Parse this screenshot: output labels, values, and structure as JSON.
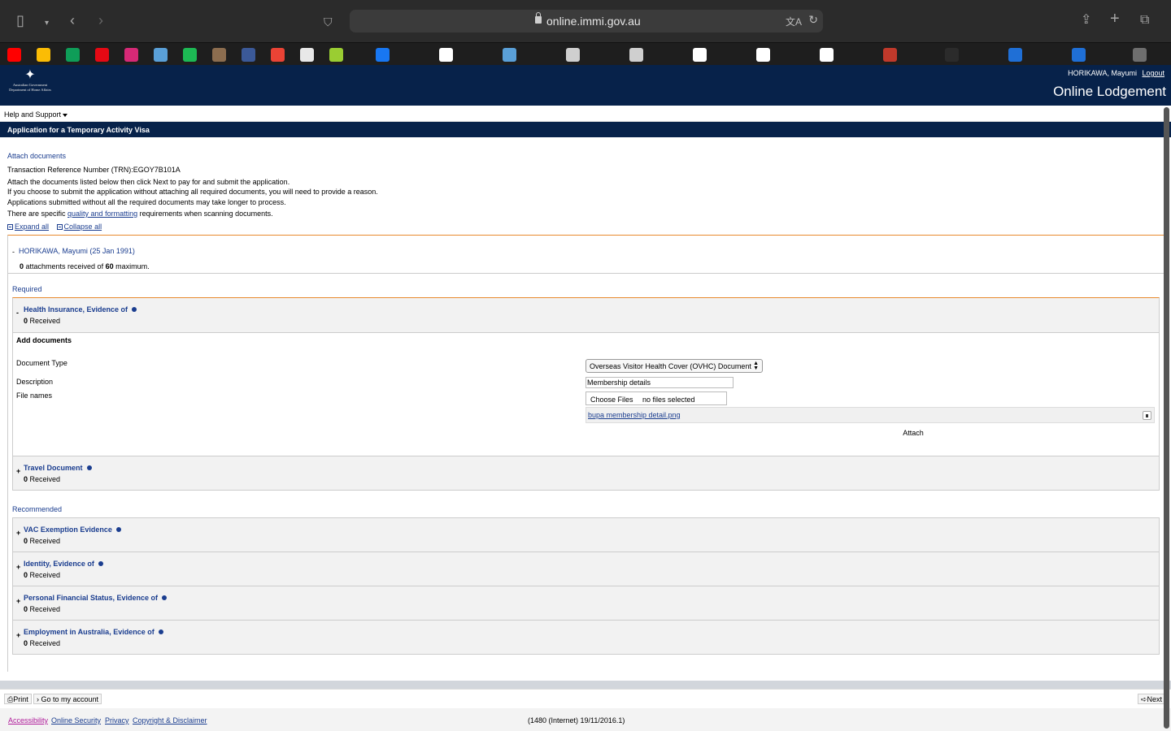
{
  "browser": {
    "url": "online.immi.gov.au",
    "icons": [
      "sidebar-icon",
      "chevron-down-icon",
      "back-icon",
      "forward-icon",
      "shield-icon",
      "lock-icon",
      "translate-icon",
      "reload-icon",
      "share-icon",
      "new-tab-icon",
      "tab-overview-icon"
    ],
    "favorites": [
      {
        "name": "youtube-favicon",
        "color": "#ff0000"
      },
      {
        "name": "photos-favicon",
        "color": "#fbbc05"
      },
      {
        "name": "sheets-favicon",
        "color": "#0f9d58"
      },
      {
        "name": "netflix-favicon",
        "color": "#e50914"
      },
      {
        "name": "instagram-favicon",
        "color": "#d62976"
      },
      {
        "name": "passwords-favicon",
        "color": "#5aa0d8"
      },
      {
        "name": "spotify-favicon",
        "color": "#1db954"
      },
      {
        "name": "game-favicon",
        "color": "#8c6d4f"
      },
      {
        "name": "facebook-square-favicon",
        "color": "#3b5998"
      },
      {
        "name": "gmail-favicon",
        "color": "#ea4335"
      },
      {
        "name": "pwc-favicon",
        "color": "#e8e8e8"
      },
      {
        "name": "docs-favicon",
        "color": "#9acd32"
      },
      {
        "name": "facebook-favicon",
        "color": "#1877f2"
      },
      {
        "name": "immi-favicon",
        "color": "#ffffff"
      },
      {
        "name": "keys-favicon",
        "color": "#5aa0d8"
      },
      {
        "name": "arrow-favicon-1",
        "color": "#cfcfcf"
      },
      {
        "name": "arrow-favicon-2",
        "color": "#cfcfcf"
      },
      {
        "name": "blank-favicon",
        "color": "#ffffff"
      },
      {
        "name": "google-favicon",
        "color": "#ffffff"
      },
      {
        "name": "red-cross-favicon",
        "color": "#ffffff"
      },
      {
        "name": "flower-favicon",
        "color": "#c0392b"
      },
      {
        "name": "star-favicon",
        "color": "#2b2b2b"
      },
      {
        "name": "health-favicon-1",
        "color": "#1f6fd6"
      },
      {
        "name": "health-favicon-2",
        "color": "#1f6fd6"
      },
      {
        "name": "w-favicon",
        "color": "#6e6e6e"
      }
    ]
  },
  "header": {
    "gov_line1": "Australian Government",
    "gov_line2": "Department of Home Affairs",
    "user": "HORIKAWA, Mayumi",
    "logout": "Logout",
    "app_name": "Online Lodgement",
    "help": "Help and Support"
  },
  "page_title": "Application for a Temporary Activity Visa",
  "intro": {
    "step": "Attach documents",
    "trn": "Transaction Reference Number (TRN):EGOY7B101A",
    "line1": "Attach the documents listed below then click Next to pay for and submit the application.",
    "line2": "If you choose to submit the application without attaching all required documents, you will need to provide a reason.",
    "line3": "Applications submitted without all the required documents may take longer to process.",
    "line4_pre": "There are specific ",
    "line4_link": "quality and formatting",
    "line4_post": " requirements when scanning documents."
  },
  "toggles": {
    "expand": "Expand all",
    "collapse": "Collapse all"
  },
  "applicant": {
    "toggle": "-",
    "name": "HORIKAWA, Mayumi (25 Jan 1991)",
    "count": "0",
    "count_mid": " attachments received of ",
    "max": "60",
    "count_end": " maximum."
  },
  "required_label": "Required",
  "recommended_label": "Recommended",
  "received_suffix": " Received",
  "health": {
    "toggle": "-",
    "title": "Health Insurance, Evidence of",
    "received": "0",
    "add_docs": "Add documents",
    "doc_type_label": "Document Type",
    "doc_type_value": "Overseas Visitor Health Cover (OVHC) Document",
    "description_label": "Description",
    "description_value": "Membership details",
    "file_names_label": "File names",
    "choose_files": "Choose Files",
    "no_files": "no files selected",
    "file": "bupa membership detail.png",
    "attach": "Attach"
  },
  "travel": {
    "toggle": "+",
    "title": "Travel Document",
    "received": "0"
  },
  "recommended": [
    {
      "toggle": "+",
      "title": "VAC Exemption Evidence",
      "received": "0"
    },
    {
      "toggle": "+",
      "title": "Identity, Evidence of",
      "received": "0"
    },
    {
      "toggle": "+",
      "title": "Personal Financial Status, Evidence of",
      "received": "0"
    },
    {
      "toggle": "+",
      "title": "Employment in Australia, Evidence of",
      "received": "0"
    }
  ],
  "footer": {
    "print": "Print",
    "account": "Go to my account",
    "next": "Next",
    "accessibility": "Accessibility",
    "security": "Online Security",
    "privacy": "Privacy",
    "copyright": "Copyright & Disclaimer",
    "version": "(1480 (Internet) 19/11/2016.1)"
  }
}
